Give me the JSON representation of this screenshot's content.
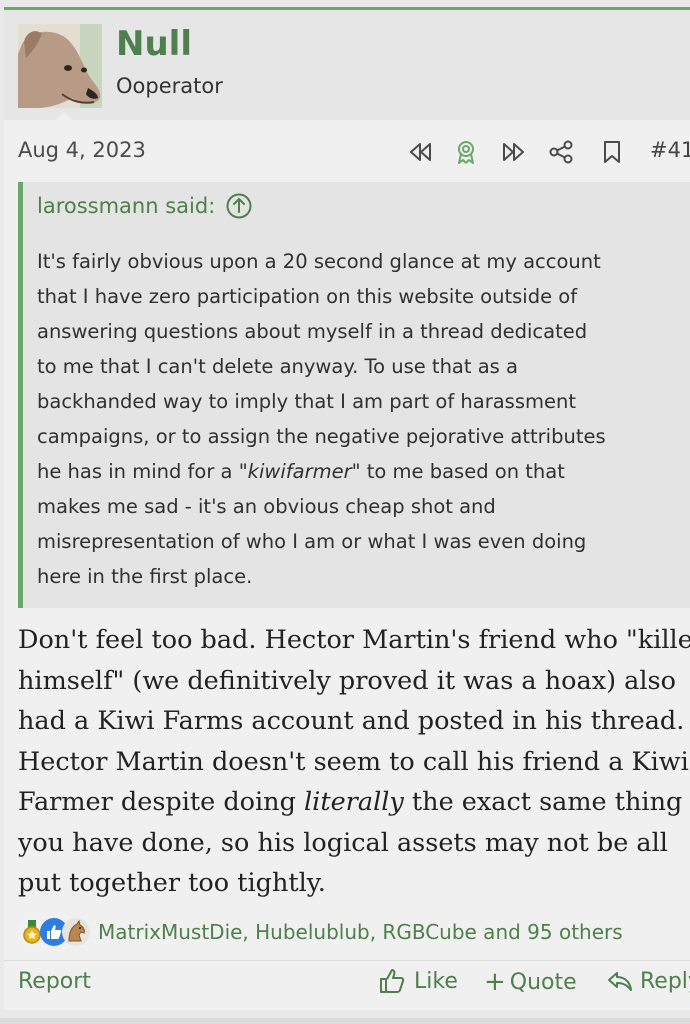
{
  "post": {
    "author": "Null",
    "user_title": "Ooperator",
    "date": "Aug 4, 2023",
    "post_number": "#41",
    "quote": {
      "author_label": "larossmann said:",
      "lines": [
        {
          "text": "It's fairly obvious upon a 20 second glance at my account"
        },
        {
          "text": "that I have zero participation on this website outside of"
        },
        {
          "text": "answering questions about myself in a thread dedicated"
        },
        {
          "text": "to me that I can't delete anyway. To use that as a"
        },
        {
          "text": "backhanded way to imply that I am part of harassment"
        },
        {
          "text": "campaigns, or to assign the negative pejorative attributes"
        },
        {
          "pre": "he has in mind for a ",
          "em": "\"kiwifarmer\"",
          "post": " to me based on that"
        },
        {
          "text": "makes me sad - it's an obvious cheap shot and"
        },
        {
          "text": "misrepresentation of who I am or what I was even doing"
        },
        {
          "text": "here in the first place."
        }
      ]
    },
    "body_lines": [
      {
        "text": "Don't feel too bad. Hector Martin's friend who \"killed"
      },
      {
        "text": "himself\" (we definitively proved it was a hoax) also"
      },
      {
        "text": "had a Kiwi Farms account and posted in his thread."
      },
      {
        "text": "Hector Martin doesn't seem to call his friend a Kiwi"
      },
      {
        "pre": "Farmer despite doing ",
        "em": "literally",
        "post": " the exact same thing"
      },
      {
        "text": "you have done, so his logical assets may not be all"
      },
      {
        "text": "put together too tightly."
      }
    ],
    "reactions": {
      "icons": [
        "medal-icon",
        "thumbs-up-icon",
        "horse-icon"
      ],
      "text": "MatrixMustDie, Hubelublub, RGBCube and 95 others"
    },
    "footer": {
      "report": "Report",
      "like": "Like",
      "quote": "Quote",
      "reply": "Reply"
    }
  },
  "colors": {
    "accent": "#4e7f4c",
    "quote_border": "#6aa768",
    "like_blue": "#2f7de1"
  }
}
